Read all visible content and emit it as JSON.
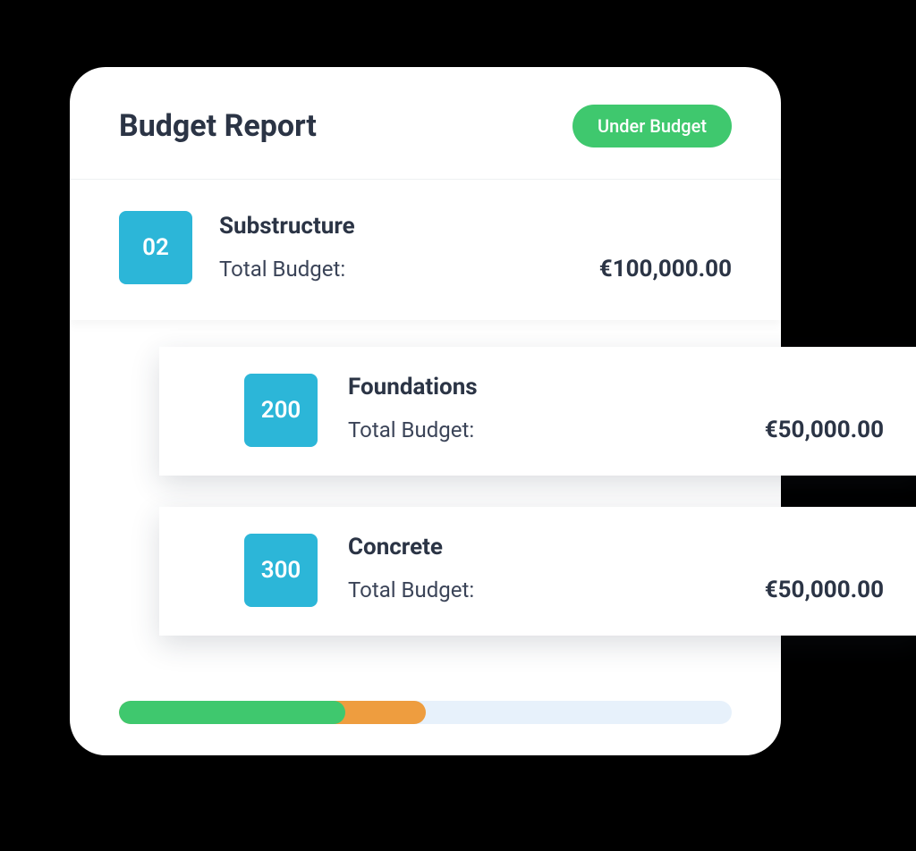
{
  "header": {
    "title": "Budget Report",
    "status_label": "Under Budget"
  },
  "summary": {
    "code": "02",
    "title": "Substructure",
    "label": "Total Budget:",
    "amount": "€100,000.00"
  },
  "sub_items": [
    {
      "code": "200",
      "title": "Foundations",
      "label": "Total Budget:",
      "amount": "€50,000.00"
    },
    {
      "code": "300",
      "title": "Concrete",
      "label": "Total Budget:",
      "amount": "€50,000.00"
    }
  ],
  "progress": {
    "green_pct": 37,
    "orange_pct": 50
  },
  "colors": {
    "accent": "#2cb6d8",
    "green": "#3fc86e",
    "orange": "#ee9d3f",
    "track": "#e7f1fb"
  }
}
